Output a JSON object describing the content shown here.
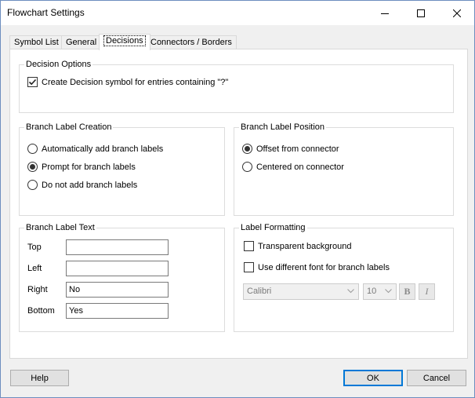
{
  "window": {
    "title": "Flowchart Settings"
  },
  "tabs": [
    {
      "label": "Symbol List"
    },
    {
      "label": "General"
    },
    {
      "label": "Decisions",
      "active": true
    },
    {
      "label": "Connectors / Borders"
    }
  ],
  "decision_options": {
    "title": "Decision Options",
    "create_decision_label": "Create Decision symbol for entries containing \"?\"",
    "create_decision_checked": true
  },
  "branch_label_creation": {
    "title": "Branch Label Creation",
    "options": [
      {
        "label": "Automatically add branch labels",
        "selected": false
      },
      {
        "label": "Prompt for branch labels",
        "selected": true
      },
      {
        "label": "Do not add branch labels",
        "selected": false
      }
    ]
  },
  "branch_label_position": {
    "title": "Branch Label Position",
    "options": [
      {
        "label": "Offset from connector",
        "selected": true
      },
      {
        "label": "Centered on connector",
        "selected": false
      }
    ]
  },
  "branch_label_text": {
    "title": "Branch Label Text",
    "fields": [
      {
        "label": "Top",
        "value": ""
      },
      {
        "label": "Left",
        "value": ""
      },
      {
        "label": "Right",
        "value": "No"
      },
      {
        "label": "Bottom",
        "value": "Yes"
      }
    ]
  },
  "label_formatting": {
    "title": "Label Formatting",
    "transparent_label": "Transparent background",
    "transparent_checked": false,
    "different_font_label": "Use different font for branch labels",
    "different_font_checked": false,
    "font_name": "Calibri",
    "font_size": "10",
    "bold_label": "B",
    "italic_label": "I"
  },
  "buttons": {
    "help": "Help",
    "ok": "OK",
    "cancel": "Cancel"
  },
  "colors": {
    "accent": "#0078d7",
    "window_bg": "#f0f0f0",
    "panel_bg": "#ffffff"
  }
}
